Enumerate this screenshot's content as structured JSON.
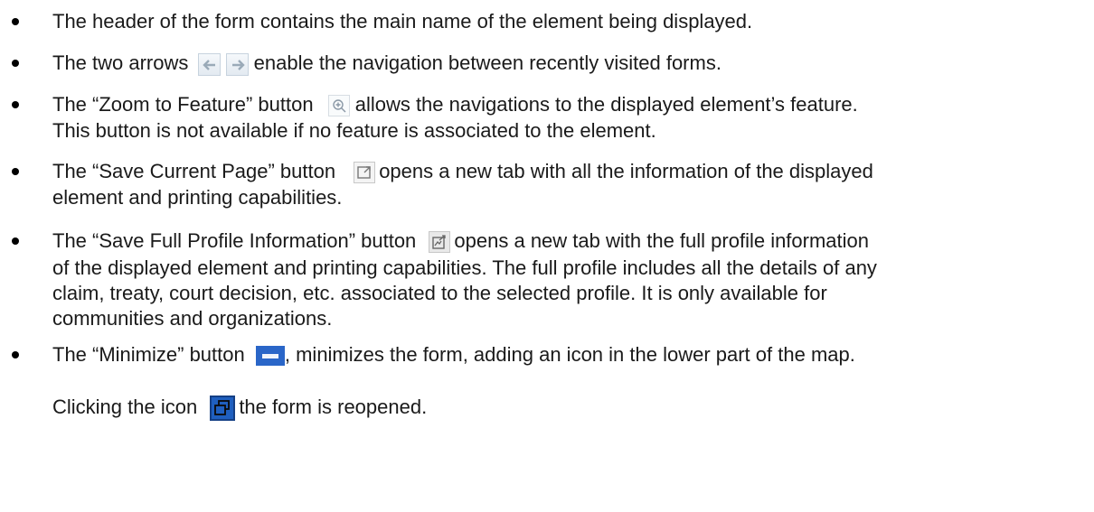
{
  "bullets": [
    {
      "lines": [
        "The header of the form contains the main name of the element being displayed."
      ]
    },
    {
      "before": "The two arrows",
      "after": "enable the navigation between recently visited forms."
    },
    {
      "before": "The “Zoom to Feature” button",
      "after": "allows the navigations to the displayed element’s feature.",
      "lines": [
        "This button is not available if no feature is associated to the element."
      ]
    },
    {
      "before": "The “Save Current Page” button",
      "after": "opens a new tab with all the information of the displayed",
      "lines": [
        "element and printing capabilities."
      ]
    },
    {
      "before": "The “Save Full Profile Information” button",
      "after": "opens a new tab with the full profile information",
      "lines": [
        "of the displayed element and printing capabilities. The full profile includes all the details of any",
        "claim, treaty, court decision, etc. associated to the selected profile. It is only available for",
        "communities and organizations."
      ]
    },
    {
      "before": "The “Minimize” button",
      "after": ", minimizes the form, adding an icon in the lower part of the map.",
      "line2_before": "Clicking the icon",
      "line2_after": "the form is reopened."
    }
  ],
  "icons": {
    "back": "arrow-left-icon",
    "forward": "arrow-right-icon",
    "zoom": "zoom-to-feature-icon",
    "save_page": "save-current-page-icon",
    "save_profile": "save-full-profile-icon",
    "minimize": "minimize-icon",
    "restore": "restore-icon"
  },
  "colors": {
    "text": "#1a1a1a",
    "minimize_blue": "#2a66c8",
    "arrow_gray": "#9aaab8"
  }
}
